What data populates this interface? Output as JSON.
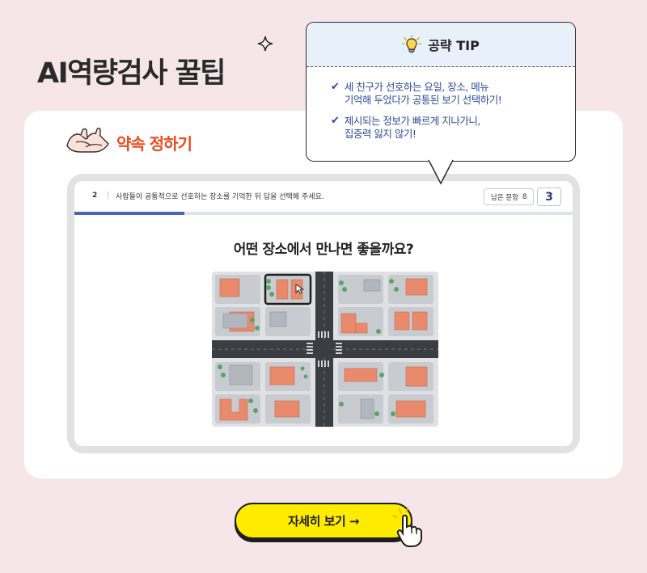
{
  "header": {
    "title": "AI역량검사 꿀팁"
  },
  "section": {
    "label": "약속 정하기"
  },
  "question": {
    "number": "2",
    "instruction": "사람들이 공통적으로 선호하는 장소를 기억한 뒤 답을 선택해 주세요.",
    "remaining_label": "남은 문항",
    "remaining_count": "8",
    "current_index": "3",
    "progress": 0.22,
    "prompt": "어떤 장소에서 만나면 좋을까요?"
  },
  "tip": {
    "title": "공략 TIP",
    "items": [
      "세 친구가 선호하는 요일, 장소, 메뉴\n기억해 두었다가 공통된 보기 선택하기!",
      "제시되는 정보가 빠르게 지나가니,\n집중력 잃지 않기!"
    ]
  },
  "cta": {
    "label": "자세히 보기 →"
  },
  "colors": {
    "background": "#f6e6ea",
    "accent_orange": "#ec4a1c",
    "tip_text": "#2f4a9b",
    "cta_yellow": "#ffeb00",
    "progress": "#4766b8"
  },
  "icons": [
    "sparkle-icon",
    "pinky-promise-icon",
    "lightbulb-icon",
    "check-icon",
    "pointer-hand-icon"
  ]
}
